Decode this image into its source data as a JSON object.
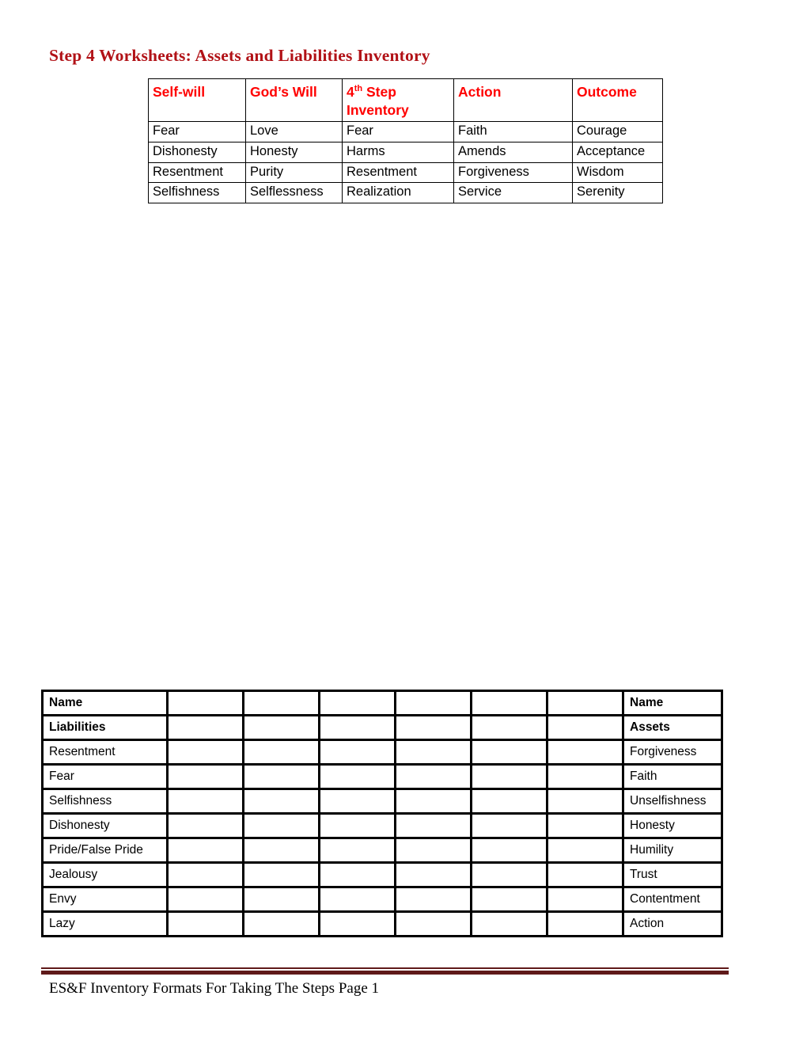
{
  "document": {
    "title": "Step 4 Worksheets: Assets and Liabilities Inventory",
    "title_color": "#b11116",
    "footer_text": "ES&F Inventory Formats For Taking The Steps Page 1",
    "footer_rule_color": "#5f1a1a"
  },
  "matrix_table": {
    "header_color": "#ff0000",
    "headers": [
      {
        "text": "Self-will",
        "sup": ""
      },
      {
        "text": "God's Will",
        "sup": ""
      },
      {
        "text": "4",
        "sup": "th",
        "rest": " Step Inventory"
      },
      {
        "text": "Action",
        "sup": ""
      },
      {
        "text": "Outcome",
        "sup": ""
      }
    ],
    "header_labels": {
      "self_will": "Self-will",
      "gods_will": "God’s Will",
      "fourth_step_num": "4",
      "fourth_step_sup": "th",
      "fourth_step_rest": " Step Inventory",
      "action": "Action",
      "outcome": "Outcome"
    },
    "rows": [
      {
        "self_will": "Fear",
        "gods_will": "Love",
        "fourth_step": "Fear",
        "action": "Faith",
        "outcome": "Courage"
      },
      {
        "self_will": "Dishonesty",
        "gods_will": "Honesty",
        "fourth_step": "Harms",
        "action": "Amends",
        "outcome": "Acceptance"
      },
      {
        "self_will": "Resentment",
        "gods_will": "Purity",
        "fourth_step": "Resentment",
        "action": "Forgiveness",
        "outcome": "Wisdom"
      },
      {
        "self_will": "Selfishness",
        "gods_will": "Selflessness",
        "fourth_step": "Realization",
        "action": "Service",
        "outcome": "Serenity"
      }
    ]
  },
  "inventory_table": {
    "blank_column_count": 6,
    "rows": [
      {
        "liability": "Name",
        "asset": "Name",
        "bold": true
      },
      {
        "liability": "Liabilities",
        "asset": "Assets",
        "bold": true
      },
      {
        "liability": "Resentment",
        "asset": "Forgiveness",
        "bold": false
      },
      {
        "liability": "Fear",
        "asset": "Faith",
        "bold": false
      },
      {
        "liability": "Selfishness",
        "asset": "Unselfishness",
        "bold": false
      },
      {
        "liability": "Dishonesty",
        "asset": "Honesty",
        "bold": false
      },
      {
        "liability": "Pride/False Pride",
        "asset": "Humility",
        "bold": false
      },
      {
        "liability": "Jealousy",
        "asset": "Trust",
        "bold": false
      },
      {
        "liability": "Envy",
        "asset": "Contentment",
        "bold": false
      },
      {
        "liability": "Lazy",
        "asset": "Action",
        "bold": false
      }
    ]
  }
}
